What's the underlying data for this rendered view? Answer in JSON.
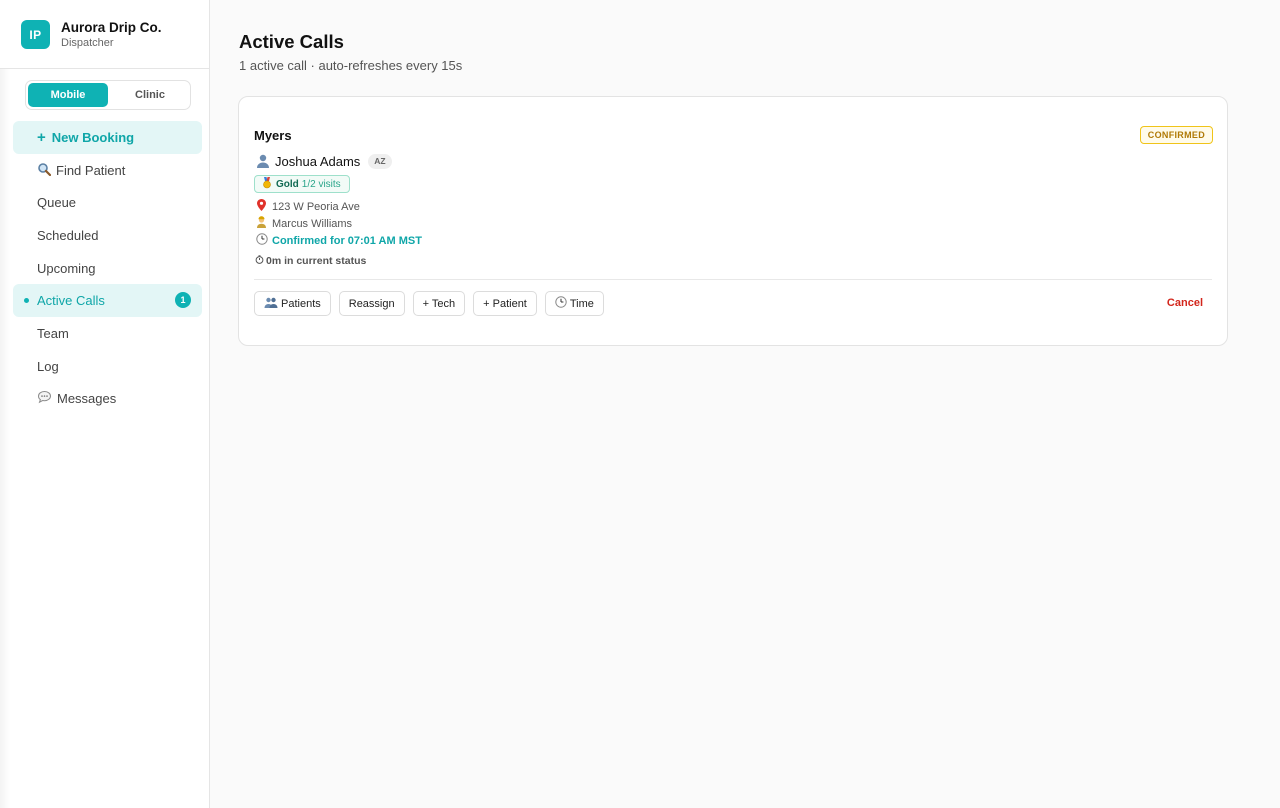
{
  "brand": {
    "initials": "IP",
    "name": "Aurora Drip Co.",
    "role": "Dispatcher",
    "accent": "#0fb2b4"
  },
  "mode_toggle": {
    "options": [
      "Mobile",
      "Clinic"
    ],
    "selected": "Mobile"
  },
  "sidebar": {
    "items": [
      {
        "label": "New Booking",
        "icon": "plus-icon",
        "state": "primary"
      },
      {
        "label": "Find Patient",
        "icon": "magnifier-icon"
      },
      {
        "label": "Queue"
      },
      {
        "label": "Scheduled"
      },
      {
        "label": "Upcoming"
      },
      {
        "label": "Active Calls",
        "state": "active",
        "badge": "1"
      },
      {
        "label": "Team"
      },
      {
        "label": "Log"
      },
      {
        "label": "Messages",
        "icon": "speech-bubble-icon"
      }
    ]
  },
  "main": {
    "title": "Active Calls",
    "subtitle": "1 active call · auto-refreshes every 15s"
  },
  "call_card": {
    "title": "Myers",
    "status": "CONFIRMED",
    "status_color": "#f0c419",
    "patient_name": "Joshua Adams",
    "state_tag": "AZ",
    "tier": {
      "name": "Gold",
      "visits": "1/2 visits",
      "icon": "medal-icon"
    },
    "address": "123 W Peoria Ave",
    "tech": "Marcus Williams",
    "confirmed_text": "Confirmed for 07:01 AM MST",
    "status_duration": "0m in current status",
    "actions": {
      "patients": "Patients",
      "reassign": "Reassign",
      "add_tech": "+ Tech",
      "add_patient": "+ Patient",
      "time": "Time",
      "cancel": "Cancel"
    },
    "cancel_color": "#d3261c"
  }
}
